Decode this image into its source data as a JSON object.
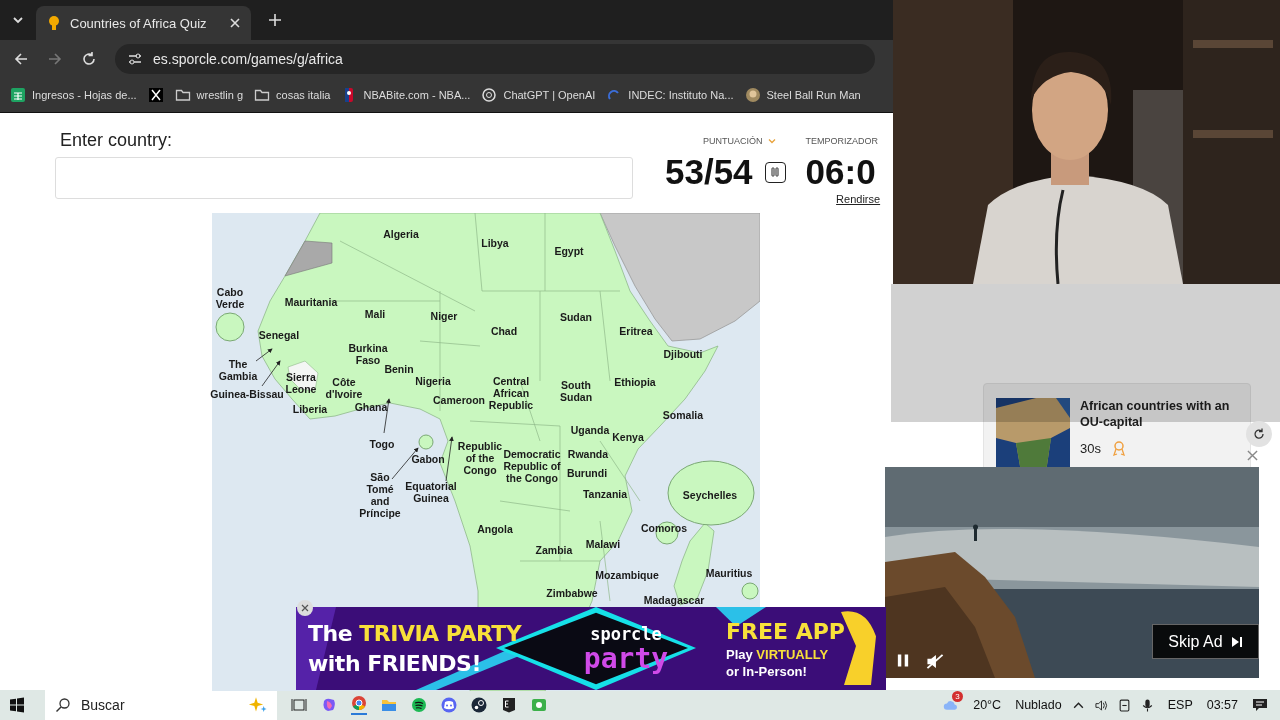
{
  "browser": {
    "tab": {
      "title": "Countries of Africa Quiz"
    },
    "url": "es.sporcle.com/games/g/africa",
    "bookmarks": [
      {
        "kind": "sheets",
        "label": "Ingresos - Hojas de..."
      },
      {
        "kind": "x"
      },
      {
        "kind": "folder",
        "label": "wrestlin g"
      },
      {
        "kind": "folder",
        "label": "cosas italia"
      },
      {
        "kind": "nba",
        "label": "NBABite.com - NBA..."
      },
      {
        "kind": "chatgpt",
        "label": "ChatGPT | OpenAI"
      },
      {
        "kind": "indec",
        "label": "INDEC: Instituto Na..."
      },
      {
        "kind": "avatar",
        "label": "Steel Ball Run Man"
      }
    ]
  },
  "quiz": {
    "prompt": "Enter country:",
    "score_label": "PUNTUACIÓN",
    "score": "53/54",
    "timer_label": "TEMPORIZADOR",
    "timer": "06:0",
    "give_up": "Rendirse"
  },
  "map": {
    "labels": [
      "Algeria",
      "Libya",
      "Egypt",
      "Cabo Verde",
      "Mauritania",
      "Mali",
      "Niger",
      "Chad",
      "Sudan",
      "Eritrea",
      "Senegal",
      "Djibouti",
      "Burkina Faso",
      "The Gambia",
      "Benin",
      "Sierra Leone",
      "Côte d'Ivoire",
      "Nigeria",
      "Central African Republic",
      "South Sudan",
      "Ethiopia",
      "Guinea-Bissau",
      "Cameroon",
      "Liberia",
      "Ghana",
      "Somalia",
      "Uganda",
      "Kenya",
      "Togo",
      "Gabon",
      "Republic of the Congo",
      "Democratic Republic of the Congo",
      "Rwanda",
      "Burundi",
      "São Tomé and Príncipe",
      "Equatorial Guinea",
      "Tanzania",
      "Seychelles",
      "Angola",
      "Comoros",
      "Zambia",
      "Malawi",
      "Mozambique",
      "Mauritius",
      "Zimbabwe",
      "Madagascar"
    ]
  },
  "related_quiz": {
    "title": "African countries with an OU-capital",
    "time": "30s"
  },
  "banner_ad": {
    "line_1": [
      {
        "text": "The",
        "highlight": false
      },
      {
        "text": "TRIVIA PARTY",
        "highlight": true
      }
    ],
    "line_2": [
      {
        "text": "with FRIENDS!",
        "highlight": false
      }
    ],
    "logo_top": "sporcle",
    "logo_bottom": "party",
    "offer": "FREE APP",
    "sub_1": [
      {
        "text": "Play",
        "highlight": false
      },
      {
        "text": "VIRTUALLY",
        "highlight": true
      }
    ],
    "sub_2": [
      {
        "text": "or In-Person!",
        "highlight": false
      }
    ]
  },
  "video_ad": {
    "skip": "Skip Ad"
  },
  "taskbar": {
    "search": "Buscar",
    "weather_badge": "3",
    "temperature": "20°C",
    "weather": "Nublado",
    "language": "ESP",
    "time": "03:57"
  }
}
